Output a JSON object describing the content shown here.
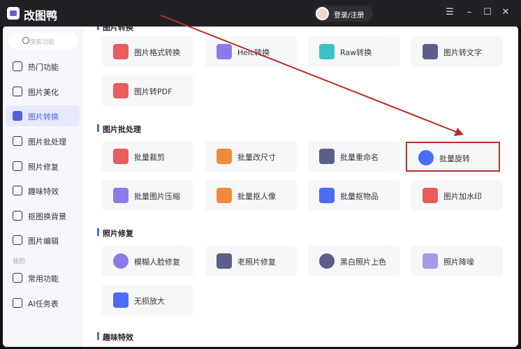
{
  "app": {
    "name": "改图鸭",
    "login": "登录/注册"
  },
  "sidebar": {
    "search_placeholder": "搜索功能",
    "items": [
      "热门功能",
      "图片美化",
      "图片转换",
      "图片批处理",
      "照片修复",
      "趣味特效",
      "抠图换背景",
      "图片编辑"
    ],
    "mine_label": "我的",
    "mine_items": [
      "常用功能",
      "AI任务表"
    ]
  },
  "sections": [
    {
      "title": "图片转换",
      "cards": [
        "图片格式转换",
        "Heic转换",
        "Raw转换",
        "图片转文字",
        "图片转PDF"
      ]
    },
    {
      "title": "图片批处理",
      "cards": [
        "批量裁剪",
        "批量改尺寸",
        "批量重命名",
        "批量旋转",
        "批量图片压缩",
        "批量抠人像",
        "批量抠物品",
        "图片加水印"
      ]
    },
    {
      "title": "照片修复",
      "cards": [
        "模糊人脸修复",
        "老照片修复",
        "黑白照片上色",
        "照片降噪",
        "无损放大"
      ]
    },
    {
      "title": "趣味特效",
      "cards": []
    }
  ],
  "colors": {
    "accent": "#5560d8",
    "annotation": "#b5302a"
  }
}
